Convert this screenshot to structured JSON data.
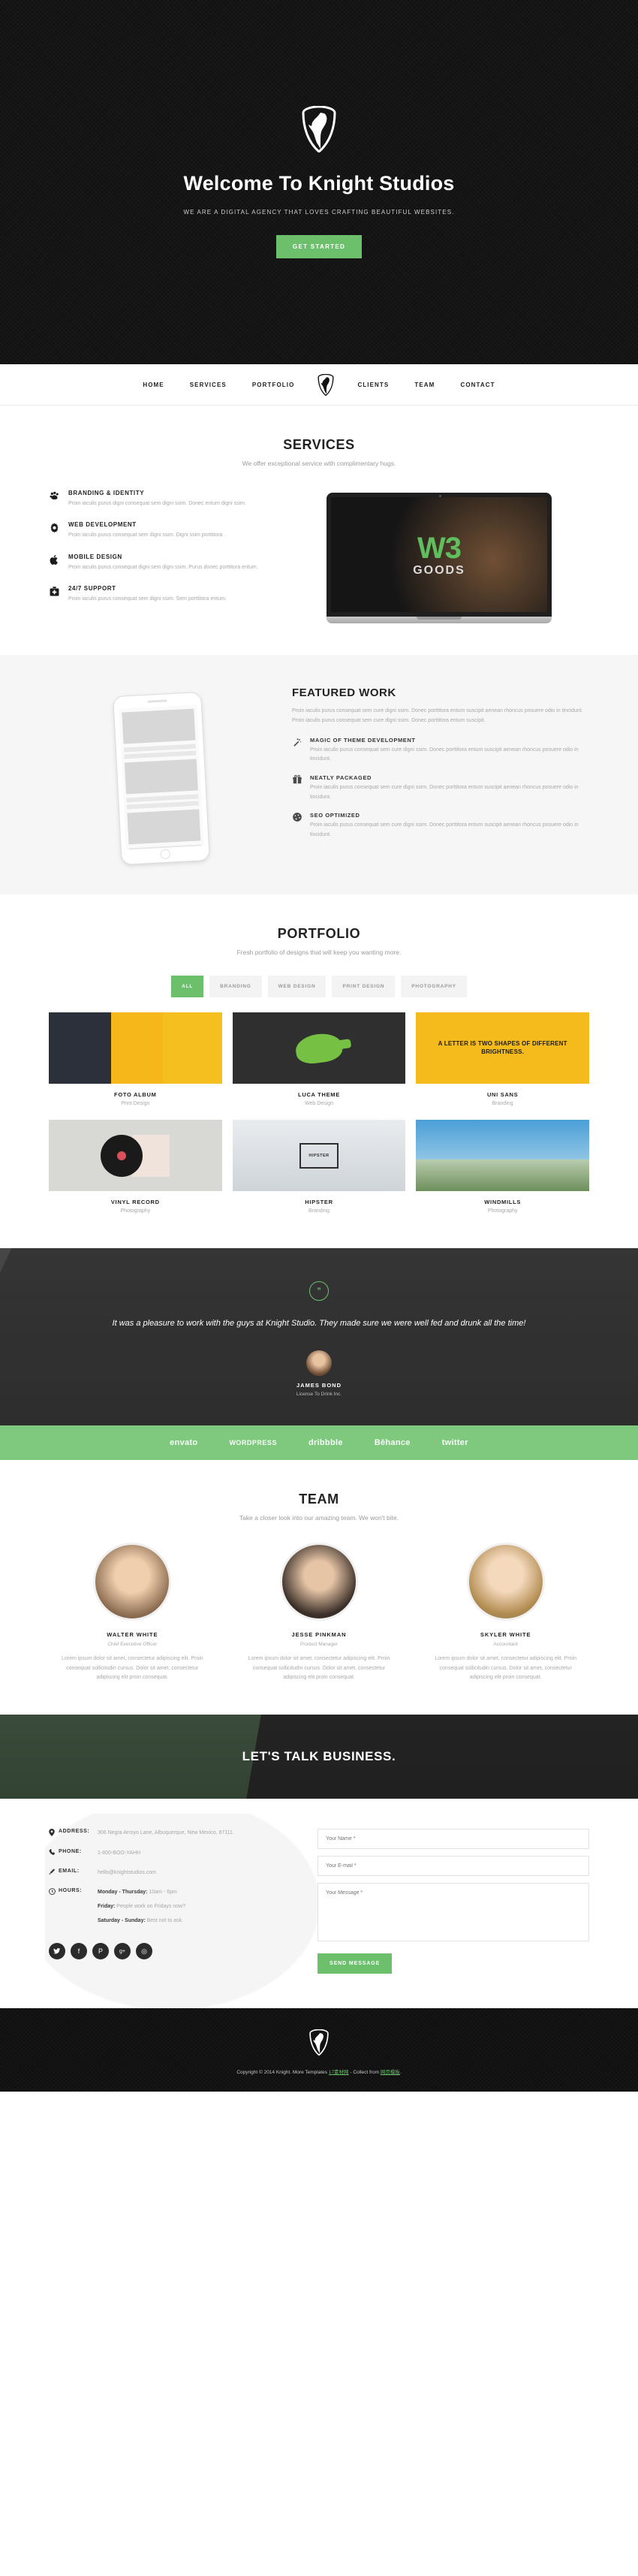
{
  "hero": {
    "logo_icon": "knight-horse-shield-logo",
    "title": "Welcome To Knight Studios",
    "subtitle": "WE ARE A DIGITAL AGENCY THAT LOVES CRAFTING BEAUTIFUL WEBSITES.",
    "cta": "GET STARTED"
  },
  "nav": {
    "left": [
      {
        "label": "HOME"
      },
      {
        "label": "SERVICES"
      },
      {
        "label": "PORTFOLIO"
      }
    ],
    "logo_icon": "knight-horse-shield-logo",
    "right": [
      {
        "label": "CLIENTS"
      },
      {
        "label": "TEAM"
      },
      {
        "label": "CONTACT"
      }
    ]
  },
  "services": {
    "title": "SERVICES",
    "subtitle": "We offer exceptional service with complimentary hugs.",
    "items": [
      {
        "icon": "paw-icon",
        "glyph": "❦",
        "title": "BRANDING & IDENTITY",
        "text": "Proin iaculis purus digni consequat sem digni ssim. Donec entum digni ssim."
      },
      {
        "icon": "gear-icon",
        "glyph": "⚙",
        "title": "WEB DEVELOPMENT",
        "text": "Proin iaculis purus consequat sem digni ssim. Digni ssim porttitora ."
      },
      {
        "icon": "apple-icon",
        "glyph": "◕",
        "title": "MOBILE DESIGN",
        "text": "Proin iaculis purus consequat digni sem digni ssim. Purus donec porttitora entum."
      },
      {
        "icon": "first-aid-kit-icon",
        "glyph": "✚",
        "title": "24/7 SUPPORT",
        "text": "Proin iaculis purus consequat sem digni ssim. Sem porttitora entum."
      }
    ],
    "laptop": {
      "screen_title": "W3",
      "screen_subtitle": "GOODS"
    }
  },
  "featured": {
    "title": "FEATURED WORK",
    "description": "Proin iaculis purus consequat sem cure digni ssim. Donec porttitora entum suscipit aenean rhoncus posuere odio in tincidunt. Proin iaculis purus consequat sem cure digni ssim. Donec porttitora entum suscipit.",
    "items": [
      {
        "icon": "magic-wand-icon",
        "glyph": "✧",
        "title": "MAGIC OF THEME DEVELOPMENT",
        "text": "Proin iaculis purus consequat sem cure digni ssim. Donec porttitora entum suscipit aenean rhoncus posuere odio in tincidunt."
      },
      {
        "icon": "gift-box-icon",
        "glyph": "Ἰ1",
        "title": "NEATLY PACKAGED",
        "text": "Proin iaculis purus consequat sem cure digni ssim. Donec porttitora entum suscipit aenean rhoncus posuere odio in tincidunt."
      },
      {
        "icon": "speedometer-icon",
        "glyph": "◔",
        "title": "SEO OPTIMIZED",
        "text": "Proin iaculis purus consequat sem cure digni ssim. Donec porttitora entum suscipit aenean rhoncus posuere odio in tincidunt."
      }
    ]
  },
  "portfolio": {
    "title": "PORTFOLIO",
    "subtitle": "Fresh portfolio of designs that will keep you wanting more.",
    "filters": [
      {
        "label": "ALL",
        "active": true
      },
      {
        "label": "BRANDING",
        "active": false
      },
      {
        "label": "WEB DESIGN",
        "active": false
      },
      {
        "label": "PRINT DESIGN",
        "active": false
      },
      {
        "label": "PHOTOGRAPHY",
        "active": false
      }
    ],
    "items": [
      {
        "title": "FOTO ALBUM",
        "category": "Print Design"
      },
      {
        "title": "LUCA THEME",
        "category": "Web Design"
      },
      {
        "title": "UNI SANS",
        "category": "Branding"
      },
      {
        "title": "VINYL RECORD",
        "category": "Photography"
      },
      {
        "title": "HIPSTER",
        "category": "Branding"
      },
      {
        "title": "WINDMILLS",
        "category": "Photography"
      }
    ],
    "thumb_uni_text": "A LETTER IS TWO SHAPES OF DIFFERENT BRIGHTNESS.",
    "thumb_hipster_text": "HIPSTER"
  },
  "testimonial": {
    "quote_icon": "quote-marks-icon",
    "quote_glyph": "”",
    "text": "It was a pleasure to work with the guys at Knight Studio. They made sure we were well fed and drunk all the time!",
    "avatar_icon": "avatar",
    "name": "JAMES BOND",
    "role": "License To Drink Inc."
  },
  "clients": {
    "logos": [
      {
        "name": "envato-logo",
        "label": "envato"
      },
      {
        "name": "wordpress-logo",
        "label": "WORDPRESS"
      },
      {
        "name": "dribbble-logo",
        "label": "dribbble"
      },
      {
        "name": "behance-logo",
        "label": "Bēhance"
      },
      {
        "name": "twitter-logo",
        "label": "twitter"
      }
    ]
  },
  "team": {
    "title": "TEAM",
    "subtitle": "Take a closer look into our amazing team. We won't bite.",
    "members": [
      {
        "name": "WALTER WHITE",
        "role": "Chief Executive Officer",
        "bio": "Lorem ipsum dolor sit amet, consectetur adipiscing elit. Proin consequat sollicitudin cursus. Dolor sit amet, consectetur adipiscing elit proin consequat."
      },
      {
        "name": "JESSE PINKMAN",
        "role": "Product Manager",
        "bio": "Lorem ipsum dolor sit amet, consectetur adipiscing elit. Proin consequat sollicitudin cursus. Dolor sit amet, consectetur adipiscing elit proin consequat."
      },
      {
        "name": "SKYLER WHITE",
        "role": "Accountant",
        "bio": "Lorem ipsum dolor sit amet, consectetur adipiscing elit. Proin consequat sollicitudin cursus. Dolor sit amet, consectetur adipiscing elit proin consequat."
      }
    ]
  },
  "business_banner": {
    "title": "LET'S TALK BUSINESS."
  },
  "contact": {
    "address_icon": "map-pin-icon",
    "address_label": "ADDRESS:",
    "address_value": "306 Negra Arroyo Lane, Albuquerque, New Mexico, 87111.",
    "phone_icon": "phone-icon",
    "phone_label": "PHONE:",
    "phone_value": "1-800-BOO-YAHH",
    "email_icon": "pencil-icon",
    "email_label": "EMAIL:",
    "email_value": "hello@knightstudios.com",
    "hours_icon": "clock-icon",
    "hours_label": "HOURS:",
    "hours": [
      {
        "days": "Monday - Thursday:",
        "value": " 10am - 6pm"
      },
      {
        "days": "Friday:",
        "value": " People work on Fridays now?"
      },
      {
        "days": "Saturday - Sunday:",
        "value": " Best not to ask."
      }
    ],
    "socials": [
      {
        "name": "twitter-icon",
        "glyph": "ᴠ"
      },
      {
        "name": "facebook-icon",
        "glyph": "f"
      },
      {
        "name": "pinterest-icon",
        "glyph": "P"
      },
      {
        "name": "google-plus-icon",
        "glyph": "g+"
      },
      {
        "name": "dribbble-icon",
        "glyph": "◎"
      }
    ],
    "form": {
      "name_placeholder": "Your Name *",
      "name_value": "",
      "email_placeholder": "Your E-mail *",
      "email_value": "",
      "message_placeholder": "Your Message *",
      "message_value": "",
      "submit_label": "SEND MESSAGE"
    }
  },
  "footer": {
    "logo_icon": "knight-horse-shield-logo",
    "copyright_pre": "Copyright © 2014 Knight. More Templates ",
    "copyright_link1": "17素材网",
    "copyright_mid": " - Collect from ",
    "copyright_link2": "网页模板",
    "copyright_post": "."
  },
  "colors": {
    "accent_green": "#6cc06c",
    "band_green": "#7fc97f",
    "dark": "#121212",
    "muted": "#a8a8a8"
  }
}
